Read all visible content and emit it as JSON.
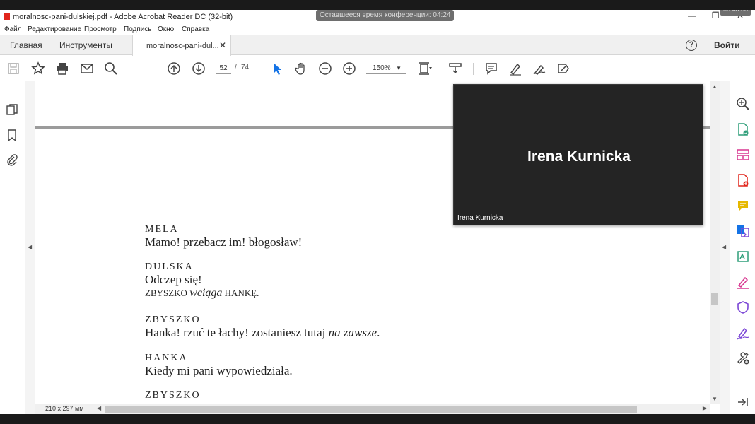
{
  "titlebar": {
    "title": "moralnosc-pani-dulskiej.pdf - Adobe Acrobat Reader DC (32-bit)",
    "conference_timer": "Оставшееся время конференции: 04:24",
    "clock": "00:48:38",
    "minimize": "—",
    "restore": "❐",
    "close": "✕"
  },
  "menu": [
    "Файл",
    "Редактирование",
    "Просмотр",
    "Подпись",
    "Окно",
    "Справка"
  ],
  "tabs": {
    "home": "Главная",
    "tools": "Инструменты",
    "document": "moralnosc-pani-dul...",
    "document_close": "✕",
    "help": "?",
    "login": "Войти"
  },
  "toolbar": {
    "current_page": "52",
    "page_separator": "/",
    "total_pages": "74",
    "zoom": "150%",
    "zoom_caret": "▼"
  },
  "document": {
    "blocks": [
      {
        "speaker": "MELA",
        "text": "Mamo! przebacz im! błogosław!"
      },
      {
        "speaker": "DULSKA",
        "text": "Odczep się!",
        "stage_a": "ZBYSZKO ",
        "stage_b": "wciąga",
        "stage_c": " HANKĘ."
      },
      {
        "speaker": "ZBYSZKO",
        "text_a": "Hanka! rzuć te łachy! zostaniesz tutaj ",
        "text_b": "na zawsze",
        "text_c": "."
      },
      {
        "speaker": "HANKA",
        "text": "Kiedy mi pani wypowiedziała."
      },
      {
        "speaker": "ZBYSZKO"
      }
    ]
  },
  "video": {
    "participant_name": "Irena Kurnicka",
    "label": "Irena Kurnicka"
  },
  "status": {
    "page_size": "210 x 297 мм"
  },
  "colors": {
    "accent_blue": "#1473e6",
    "pdf_red": "#e1251b",
    "tool_green": "#2d9d78",
    "tool_purple": "#7c48d6",
    "tool_pink": "#d83790",
    "tool_yellow": "#e6b800"
  }
}
